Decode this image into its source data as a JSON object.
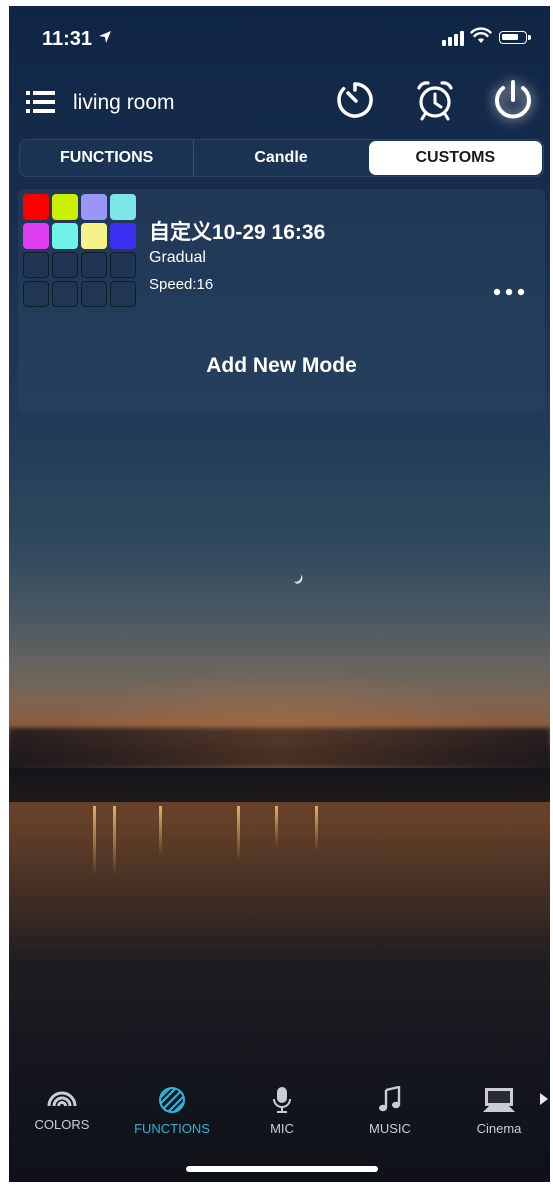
{
  "status_bar": {
    "time": "11:31"
  },
  "header": {
    "room_name": "living room"
  },
  "tabs": [
    {
      "label": "FUNCTIONS",
      "active": false
    },
    {
      "label": "Candle",
      "active": false
    },
    {
      "label": "CUSTOMS",
      "active": true
    }
  ],
  "modes": [
    {
      "name": "自定义10-29 16:36",
      "type": "Gradual",
      "speed": "Speed:16",
      "colors": [
        "#ff0000",
        "#c8f000",
        "#9b96f5",
        "#7ee6e6",
        "#e03cf0",
        "#6ff2ea",
        "#f6f28a",
        "#3b2ff2"
      ]
    }
  ],
  "add_mode_label": "Add New Mode",
  "bottom_nav": [
    {
      "label": "COLORS",
      "icon": "rainbow-icon",
      "active": false
    },
    {
      "label": "FUNCTIONS",
      "icon": "striped-circle-icon",
      "active": true
    },
    {
      "label": "MIC",
      "icon": "microphone-icon",
      "active": false
    },
    {
      "label": "MUSIC",
      "icon": "music-note-icon",
      "active": false
    },
    {
      "label": "Cinema",
      "icon": "cinema-screen-icon",
      "active": false
    }
  ],
  "colors": {
    "accent": "#2fb3d9",
    "active_tab_bg": "#ffffff",
    "active_tab_text": "#1a1a1a"
  }
}
